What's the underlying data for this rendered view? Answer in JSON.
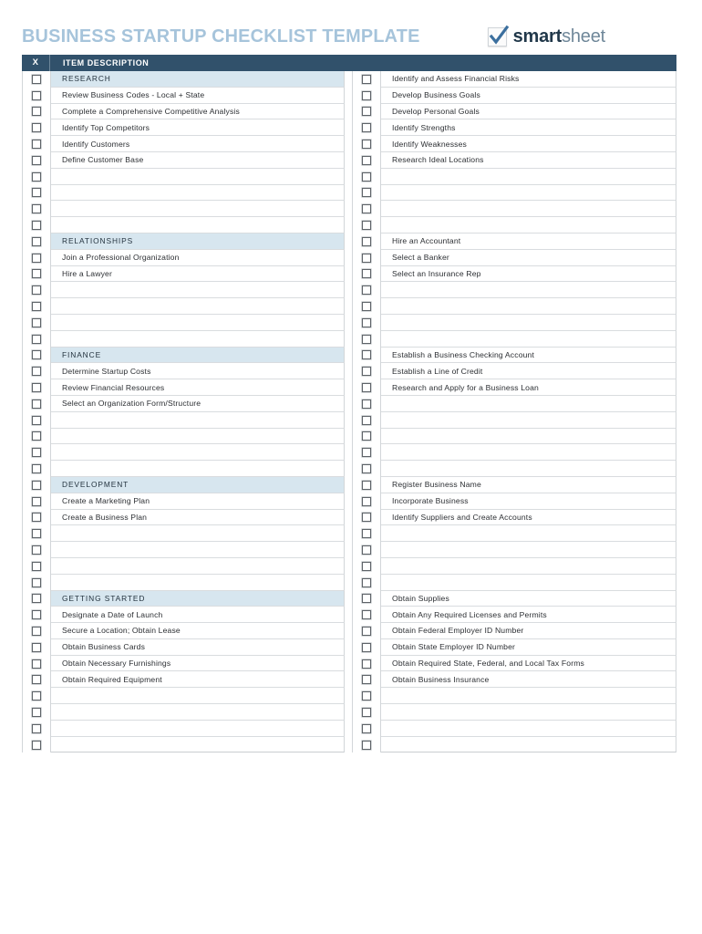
{
  "document": {
    "title": "BUSINESS STARTUP CHECKLIST TEMPLATE",
    "title_color": "#a6c4db"
  },
  "brand": {
    "icon": "checkmark-checkbox-icon",
    "name_part1": "smart",
    "name_part2": "sheet",
    "color_part1": "#21384a",
    "color_part2": "#6f8799",
    "check_color": "#3b6f9e"
  },
  "table": {
    "header_bg": "#31516b",
    "section_bg": "#d7e6ef",
    "columns": {
      "check": "X",
      "description": "ITEM DESCRIPTION"
    }
  },
  "checklist": {
    "left_column": [
      {
        "type": "section",
        "label": "RESEARCH"
      },
      {
        "type": "item",
        "label": "Review Business Codes - Local + State"
      },
      {
        "type": "item",
        "label": "Complete a Comprehensive Competitive Analysis"
      },
      {
        "type": "item",
        "label": "Identify Top Competitors"
      },
      {
        "type": "item",
        "label": "Identify Customers"
      },
      {
        "type": "item",
        "label": "Define Customer Base"
      },
      {
        "type": "blank",
        "label": ""
      },
      {
        "type": "blank",
        "label": ""
      },
      {
        "type": "blank",
        "label": ""
      },
      {
        "type": "blank",
        "label": ""
      },
      {
        "type": "section",
        "label": "RELATIONSHIPS"
      },
      {
        "type": "item",
        "label": "Join a Professional Organization"
      },
      {
        "type": "item",
        "label": "Hire a Lawyer"
      },
      {
        "type": "blank",
        "label": ""
      },
      {
        "type": "blank",
        "label": ""
      },
      {
        "type": "blank",
        "label": ""
      },
      {
        "type": "blank",
        "label": ""
      },
      {
        "type": "section",
        "label": "FINANCE"
      },
      {
        "type": "item",
        "label": "Determine Startup Costs"
      },
      {
        "type": "item",
        "label": "Review Financial Resources"
      },
      {
        "type": "item",
        "label": "Select an Organization Form/Structure"
      },
      {
        "type": "blank",
        "label": ""
      },
      {
        "type": "blank",
        "label": ""
      },
      {
        "type": "blank",
        "label": ""
      },
      {
        "type": "blank",
        "label": ""
      },
      {
        "type": "section",
        "label": "DEVELOPMENT"
      },
      {
        "type": "item",
        "label": "Create a Marketing Plan"
      },
      {
        "type": "item",
        "label": "Create a Business Plan"
      },
      {
        "type": "blank",
        "label": ""
      },
      {
        "type": "blank",
        "label": ""
      },
      {
        "type": "blank",
        "label": ""
      },
      {
        "type": "blank",
        "label": ""
      },
      {
        "type": "section",
        "label": "GETTING STARTED"
      },
      {
        "type": "item",
        "label": "Designate a Date of Launch"
      },
      {
        "type": "item",
        "label": "Secure a Location;  Obtain Lease"
      },
      {
        "type": "item",
        "label": "Obtain Business Cards"
      },
      {
        "type": "item",
        "label": "Obtain Necessary Furnishings"
      },
      {
        "type": "item",
        "label": "Obtain Required Equipment"
      },
      {
        "type": "blank",
        "label": ""
      },
      {
        "type": "blank",
        "label": ""
      },
      {
        "type": "blank",
        "label": ""
      },
      {
        "type": "blank",
        "label": ""
      }
    ],
    "right_column": [
      {
        "type": "item",
        "label": "Identify and Assess Financial Risks"
      },
      {
        "type": "item",
        "label": "Develop Business Goals"
      },
      {
        "type": "item",
        "label": "Develop Personal Goals"
      },
      {
        "type": "item",
        "label": "Identify Strengths"
      },
      {
        "type": "item",
        "label": "Identify Weaknesses"
      },
      {
        "type": "item",
        "label": "Research Ideal Locations"
      },
      {
        "type": "blank",
        "label": ""
      },
      {
        "type": "blank",
        "label": ""
      },
      {
        "type": "blank",
        "label": ""
      },
      {
        "type": "blank",
        "label": ""
      },
      {
        "type": "item",
        "label": "Hire an Accountant"
      },
      {
        "type": "item",
        "label": "Select a Banker"
      },
      {
        "type": "item",
        "label": "Select an Insurance Rep"
      },
      {
        "type": "blank",
        "label": ""
      },
      {
        "type": "blank",
        "label": ""
      },
      {
        "type": "blank",
        "label": ""
      },
      {
        "type": "blank",
        "label": ""
      },
      {
        "type": "item",
        "label": "Establish a Business Checking Account"
      },
      {
        "type": "item",
        "label": "Establish a Line of Credit"
      },
      {
        "type": "item",
        "label": "Research and Apply for a Business Loan"
      },
      {
        "type": "blank",
        "label": ""
      },
      {
        "type": "blank",
        "label": ""
      },
      {
        "type": "blank",
        "label": ""
      },
      {
        "type": "blank",
        "label": ""
      },
      {
        "type": "blank",
        "label": ""
      },
      {
        "type": "item",
        "label": "Register Business Name"
      },
      {
        "type": "item",
        "label": "Incorporate Business"
      },
      {
        "type": "item",
        "label": "Identify Suppliers and Create Accounts"
      },
      {
        "type": "blank",
        "label": ""
      },
      {
        "type": "blank",
        "label": ""
      },
      {
        "type": "blank",
        "label": ""
      },
      {
        "type": "blank",
        "label": ""
      },
      {
        "type": "item",
        "label": "Obtain Supplies"
      },
      {
        "type": "item",
        "label": "Obtain Any Required Licenses and Permits"
      },
      {
        "type": "item",
        "label": "Obtain Federal Employer ID Number"
      },
      {
        "type": "item",
        "label": "Obtain State Employer ID Number"
      },
      {
        "type": "item",
        "label": "Obtain Required State, Federal, and Local Tax Forms"
      },
      {
        "type": "item",
        "label": "Obtain Business Insurance"
      },
      {
        "type": "blank",
        "label": ""
      },
      {
        "type": "blank",
        "label": ""
      },
      {
        "type": "blank",
        "label": ""
      },
      {
        "type": "blank",
        "label": ""
      }
    ]
  }
}
